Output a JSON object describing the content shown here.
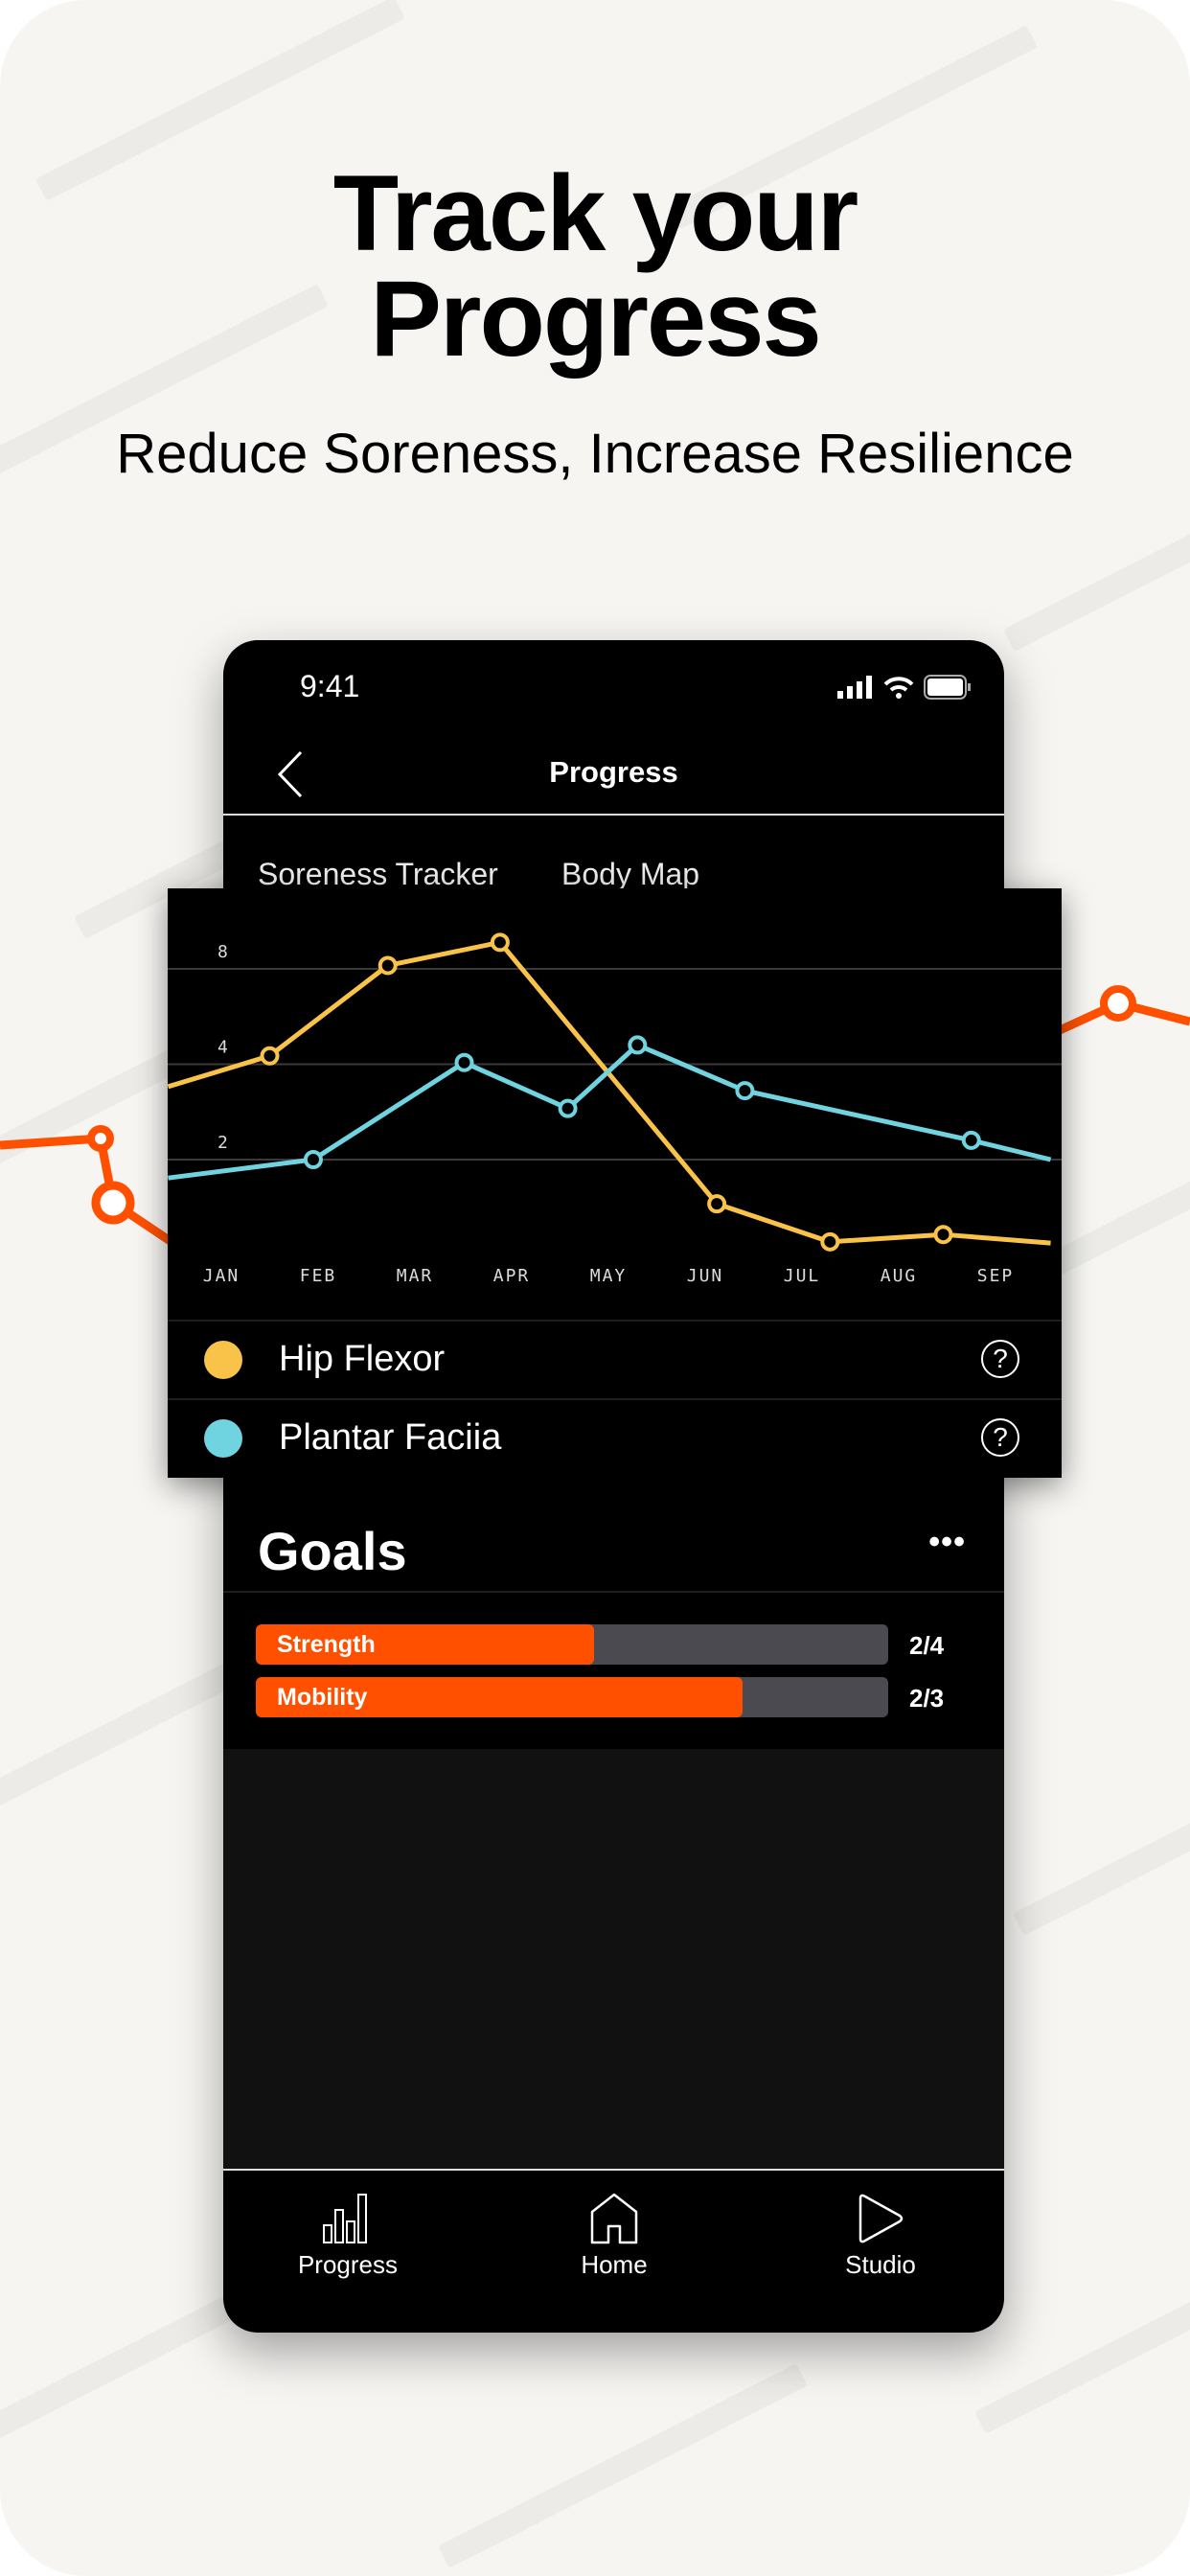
{
  "promo": {
    "headline_line1": "Track your",
    "headline_line2": "Progress",
    "subheadline": "Reduce Soreness, Increase Resilience",
    "accent": "#ff5000",
    "background": "#f6f5f2"
  },
  "status_bar": {
    "time": "9:41",
    "icons": [
      "signal-icon",
      "wifi-icon",
      "battery-icon"
    ]
  },
  "nav": {
    "title": "Progress",
    "back_icon": "chevron-left-icon"
  },
  "tabs": [
    {
      "label": "Soreness Tracker"
    },
    {
      "label": "Body Map"
    }
  ],
  "chart_data": {
    "type": "line",
    "y_scale": "log2",
    "y_ticks": [
      "8",
      "4",
      "2"
    ],
    "y_tick_values": [
      8,
      4,
      2
    ],
    "categories": [
      "JAN",
      "FEB",
      "MAR",
      "APR",
      "MAY",
      "JUN",
      "JUL",
      "AUG",
      "SEP"
    ],
    "grid": true,
    "legend": "bottom",
    "series": [
      {
        "name": "Hip Flexor",
        "color": "#f9c349",
        "points": [
          {
            "x": -0.55,
            "y": 3.4,
            "marker": false
          },
          {
            "x": 0.5,
            "y": 4.25,
            "marker": true
          },
          {
            "x": 1.72,
            "y": 8.2,
            "marker": true
          },
          {
            "x": 2.88,
            "y": 9.7,
            "marker": true
          },
          {
            "x": 5.12,
            "y": 1.45,
            "marker": true
          },
          {
            "x": 6.29,
            "y": 1.1,
            "marker": true
          },
          {
            "x": 7.46,
            "y": 1.16,
            "marker": true
          },
          {
            "x": 8.57,
            "y": 1.09,
            "marker": false
          }
        ]
      },
      {
        "name": "Plantar Faciia",
        "color": "#6fd3e0",
        "points": [
          {
            "x": -0.55,
            "y": 1.75,
            "marker": false
          },
          {
            "x": 0.95,
            "y": 2.0,
            "marker": true
          },
          {
            "x": 2.51,
            "y": 4.05,
            "marker": true
          },
          {
            "x": 3.58,
            "y": 2.9,
            "marker": true
          },
          {
            "x": 4.3,
            "y": 4.6,
            "marker": true
          },
          {
            "x": 5.41,
            "y": 3.3,
            "marker": true
          },
          {
            "x": 7.75,
            "y": 2.3,
            "marker": true
          },
          {
            "x": 8.57,
            "y": 2.0,
            "marker": false
          }
        ]
      }
    ]
  },
  "legend": [
    {
      "label": "Hip Flexor",
      "color": "#f9c349",
      "help": "?"
    },
    {
      "label": "Plantar Faciia",
      "color": "#6fd3e0",
      "help": "?"
    }
  ],
  "goals": {
    "title": "Goals",
    "more": "•••",
    "items": [
      {
        "label": "Strength",
        "count": "2/4",
        "fill": 0.535
      },
      {
        "label": "Mobility",
        "count": "2/3",
        "fill": 0.77
      }
    ]
  },
  "tab_bar": [
    {
      "label": "Progress",
      "icon": "bar-chart-icon"
    },
    {
      "label": "Home",
      "icon": "home-icon"
    },
    {
      "label": "Studio",
      "icon": "play-icon"
    }
  ]
}
